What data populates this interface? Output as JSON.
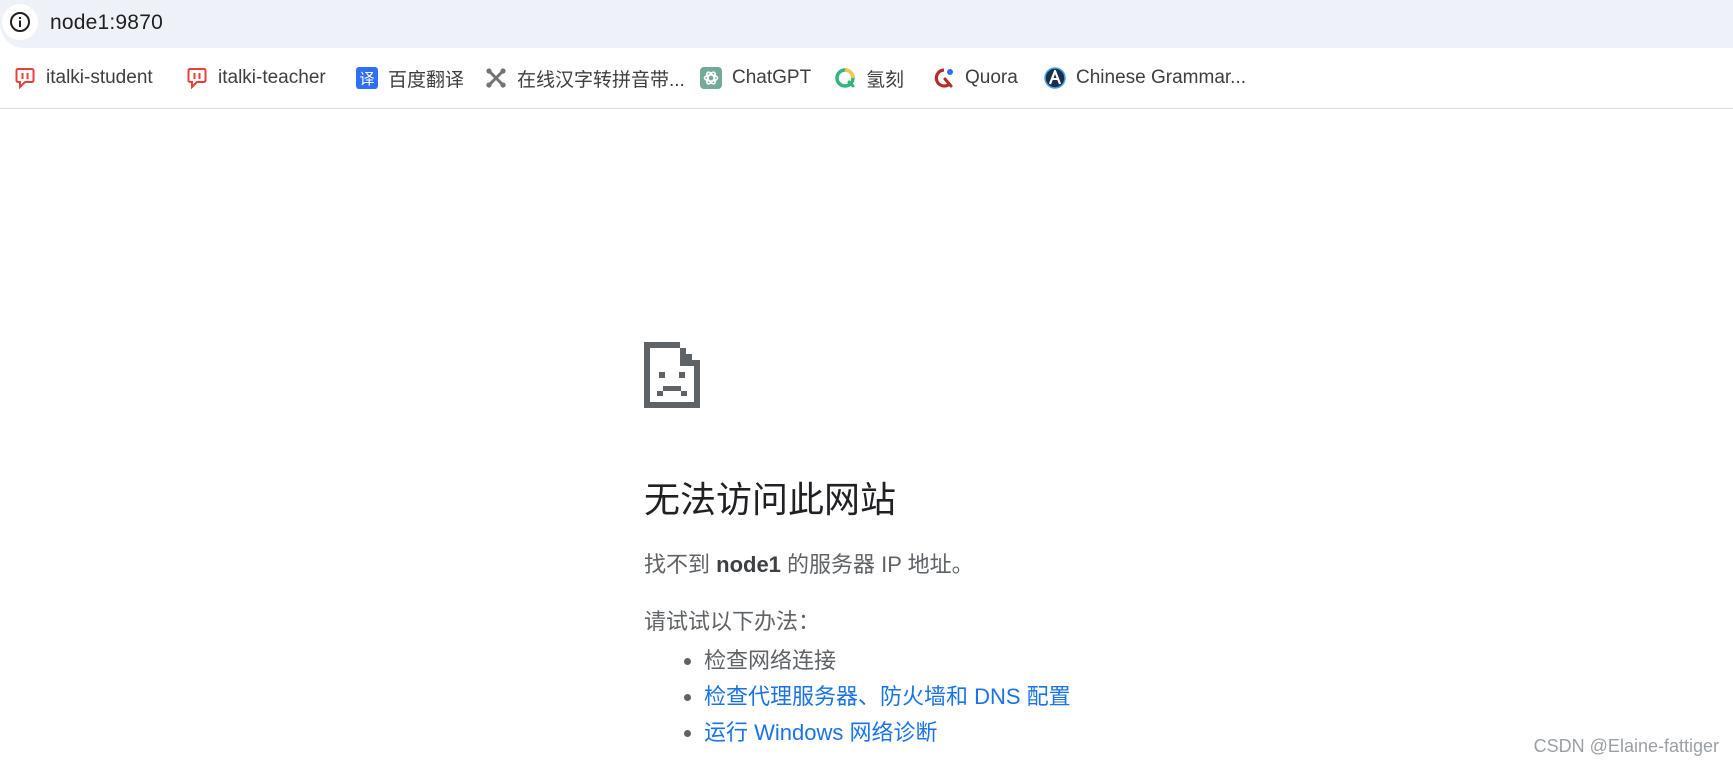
{
  "address_bar": {
    "url": "node1:9870",
    "icon": "info-icon"
  },
  "bookmarks": [
    {
      "label": "italki-student",
      "icon": "italki-icon",
      "color": "#e8403a"
    },
    {
      "label": "italki-teacher",
      "icon": "italki-icon",
      "color": "#e8403a"
    },
    {
      "label": "百度翻译",
      "icon": "baidu-translate-icon",
      "glyph": "译",
      "color": "#2f6ff1"
    },
    {
      "label": "在线汉字转拼音带...",
      "icon": "joomla-icon",
      "color": "#6f7478"
    },
    {
      "label": "ChatGPT",
      "icon": "chatgpt-icon",
      "color": "#74aa9c"
    },
    {
      "label": "氢刻",
      "icon": "qingke-icon",
      "color": "#36b37e"
    },
    {
      "label": "Quora",
      "icon": "quora-icon",
      "color": "#b92b27"
    },
    {
      "label": "Chinese Grammar...",
      "icon": "chinese-grammar-icon",
      "color": "#1b2e4b"
    }
  ],
  "error": {
    "icon": "sad-document-icon",
    "title": "无法访问此网站",
    "desc_prefix": "找不到 ",
    "desc_host": "node1",
    "desc_suffix": " 的服务器 IP 地址。",
    "suggestions_heading": "请试试以下办法：",
    "suggestions": [
      {
        "text": "检查网络连接",
        "link": false
      },
      {
        "text": "检查代理服务器、防火墙和 DNS 配置",
        "link": true
      },
      {
        "text": "运行 Windows 网络诊断",
        "link": true
      }
    ]
  },
  "watermark": "CSDN @Elaine-fattiger",
  "colors": {
    "link": "#1a73e8",
    "text_secondary": "#5f6368",
    "address_bar_bg": "#eef1f8"
  }
}
